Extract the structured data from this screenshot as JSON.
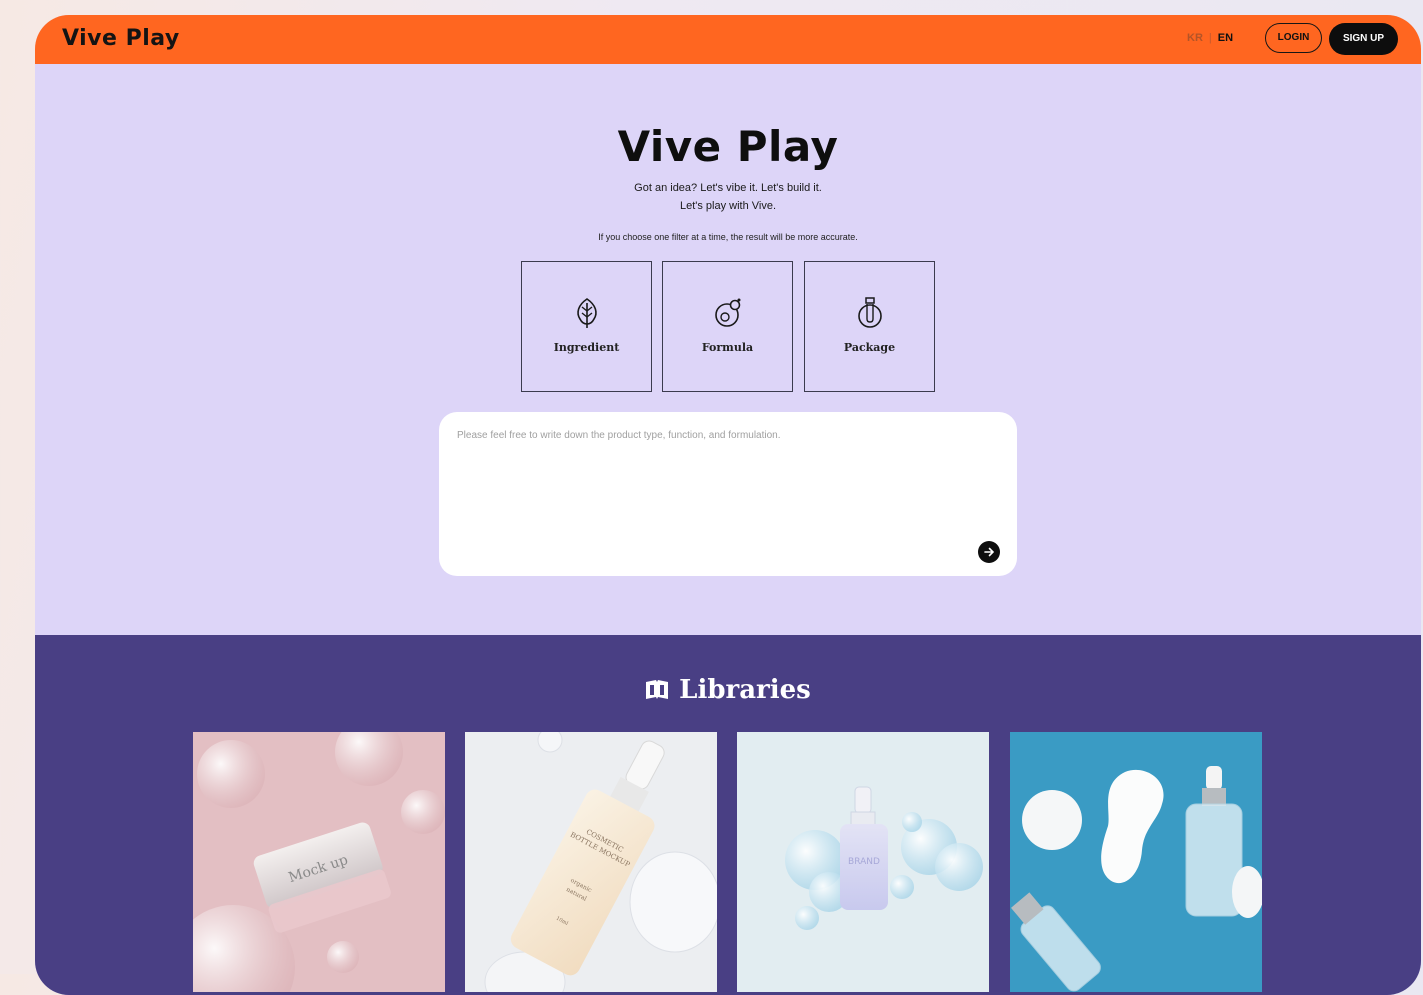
{
  "brand": {
    "logo": "Vive Play",
    "accent": "#ff6620",
    "hero_bg": "#ddd5f8",
    "library_bg": "#493f84"
  },
  "topbar": {
    "lang_kr": "KR",
    "lang_sep": "|",
    "lang_en": "EN",
    "login_label": "LOGIN",
    "signup_label": "SIGN UP"
  },
  "hero": {
    "title": "Vive Play",
    "tagline_line1": "Got an idea? Let's vibe it. Let's build it.",
    "tagline_line2": "Let's play with Vive.",
    "hint": "If you choose one filter at a time, the result will be more accurate."
  },
  "filters": [
    {
      "label": "Ingredient",
      "icon": "leaf-icon"
    },
    {
      "label": "Formula",
      "icon": "flask-icon"
    },
    {
      "label": "Package",
      "icon": "bottle-icon"
    }
  ],
  "prompt": {
    "placeholder": "Please feel free to write down the product type, function, and formulation.",
    "value": "",
    "send_icon": "arrow-right-icon"
  },
  "libraries": {
    "title": "Libraries",
    "icon": "book-icon",
    "cards": [
      {
        "image": "cream-jar-mockup",
        "jar_label": "Mock up"
      },
      {
        "image": "serum-dropper-bottle",
        "bottle_label_1": "COSMETIC",
        "bottle_label_2": "BOTTLE MOCKUP",
        "bottle_label_3": "organic",
        "bottle_label_4": "natural",
        "bottle_label_5": "10ml"
      },
      {
        "image": "brand-bottle-bubbles",
        "bottle_label": "BRAND"
      },
      {
        "image": "serum-bottles-gua-sha"
      }
    ]
  }
}
